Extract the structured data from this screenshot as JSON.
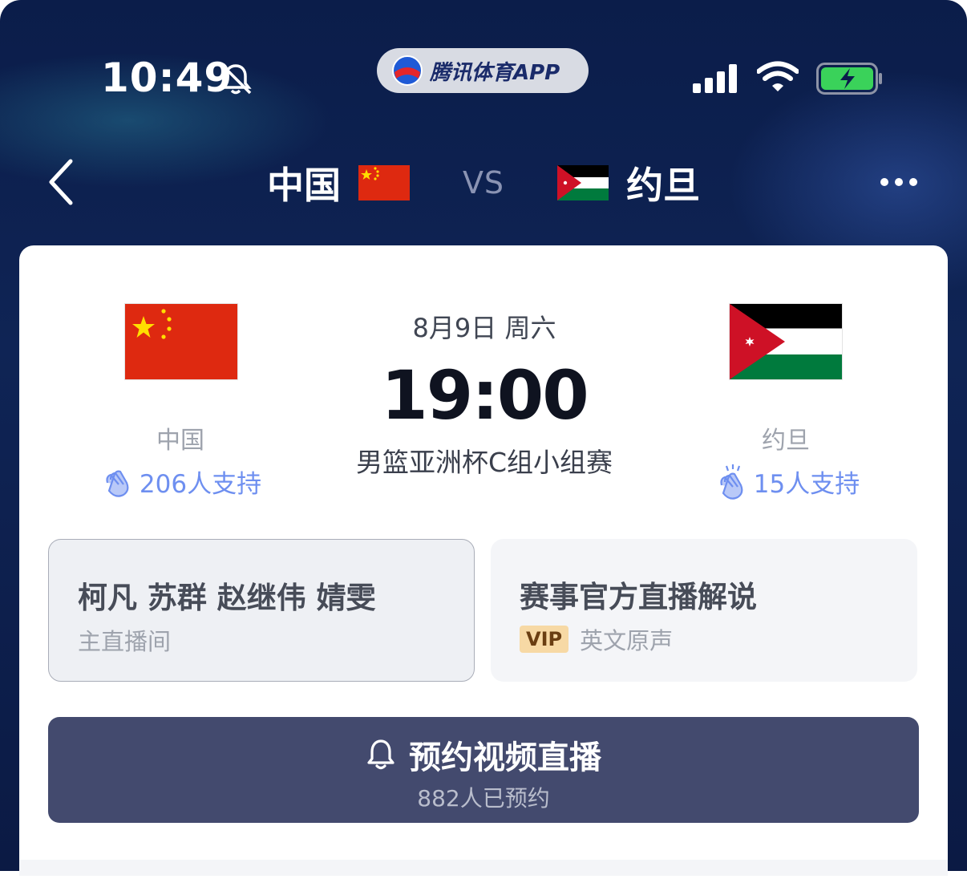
{
  "status_bar": {
    "time": "10:49",
    "app_name": "腾讯体育APP"
  },
  "nav": {
    "home_team": "中国",
    "vs": "VS",
    "away_team": "约旦"
  },
  "match": {
    "date": "8月9日 周六",
    "time": "19:00",
    "round": "男篮亚洲杯C组小组赛",
    "home": {
      "name": "中国",
      "support": "206人支持"
    },
    "away": {
      "name": "约旦",
      "support": "15人支持"
    }
  },
  "streams": [
    {
      "title": "柯凡 苏群 赵继伟 婧雯",
      "subtitle": "主直播间"
    },
    {
      "title": "赛事官方直播解说",
      "badge": "VIP",
      "subtitle": "英文原声"
    }
  ],
  "reserve": {
    "label": "预约视频直播",
    "count": "882人已预约"
  },
  "colors": {
    "accent": "#6e8ff0",
    "button_bg": "#434a6e",
    "china_red": "#de2910",
    "china_yellow": "#ffde00",
    "jordan_red": "#ce1126",
    "jordan_green": "#007a3d"
  },
  "icons": [
    "bell-off-icon",
    "signal-icon",
    "wifi-icon",
    "battery-charging-icon",
    "back-icon",
    "more-icon",
    "clap-icon",
    "bell-icon"
  ]
}
